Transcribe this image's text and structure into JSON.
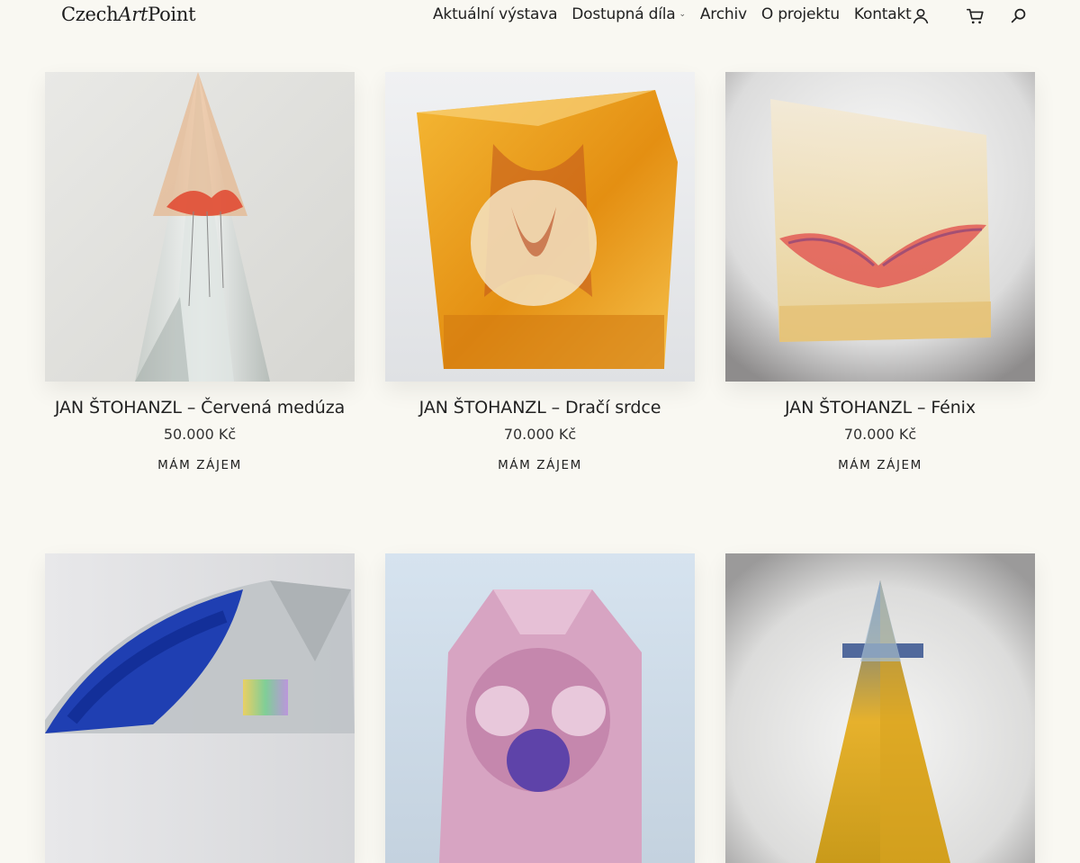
{
  "header": {
    "logo": {
      "part1": "Czech",
      "part2": "Art",
      "part3": "Point"
    },
    "nav": [
      {
        "label": "Aktuální výstava"
      },
      {
        "label": "Dostupná díla",
        "dropdown": true
      },
      {
        "label": "Archiv"
      },
      {
        "label": "O projektu"
      },
      {
        "label": "Kontakt"
      }
    ],
    "icons": [
      "user-icon",
      "cart-icon",
      "search-icon"
    ]
  },
  "colors": {
    "background": "#f9f8f2",
    "text": "#222222",
    "logo_accent": "#d23a2c"
  },
  "products": [
    {
      "title": "JAN ŠTOHANZL – Červená medúza",
      "price": "50.000 Kč",
      "cta": "Mám zájem"
    },
    {
      "title": "JAN ŠTOHANZL – Dračí srdce",
      "price": "70.000 Kč",
      "cta": "Mám zájem"
    },
    {
      "title": "JAN ŠTOHANZL – Fénix",
      "price": "70.000 Kč",
      "cta": "Mám zájem"
    },
    {
      "title": "",
      "price": "",
      "cta": ""
    },
    {
      "title": "",
      "price": "",
      "cta": ""
    },
    {
      "title": "",
      "price": "",
      "cta": ""
    }
  ]
}
